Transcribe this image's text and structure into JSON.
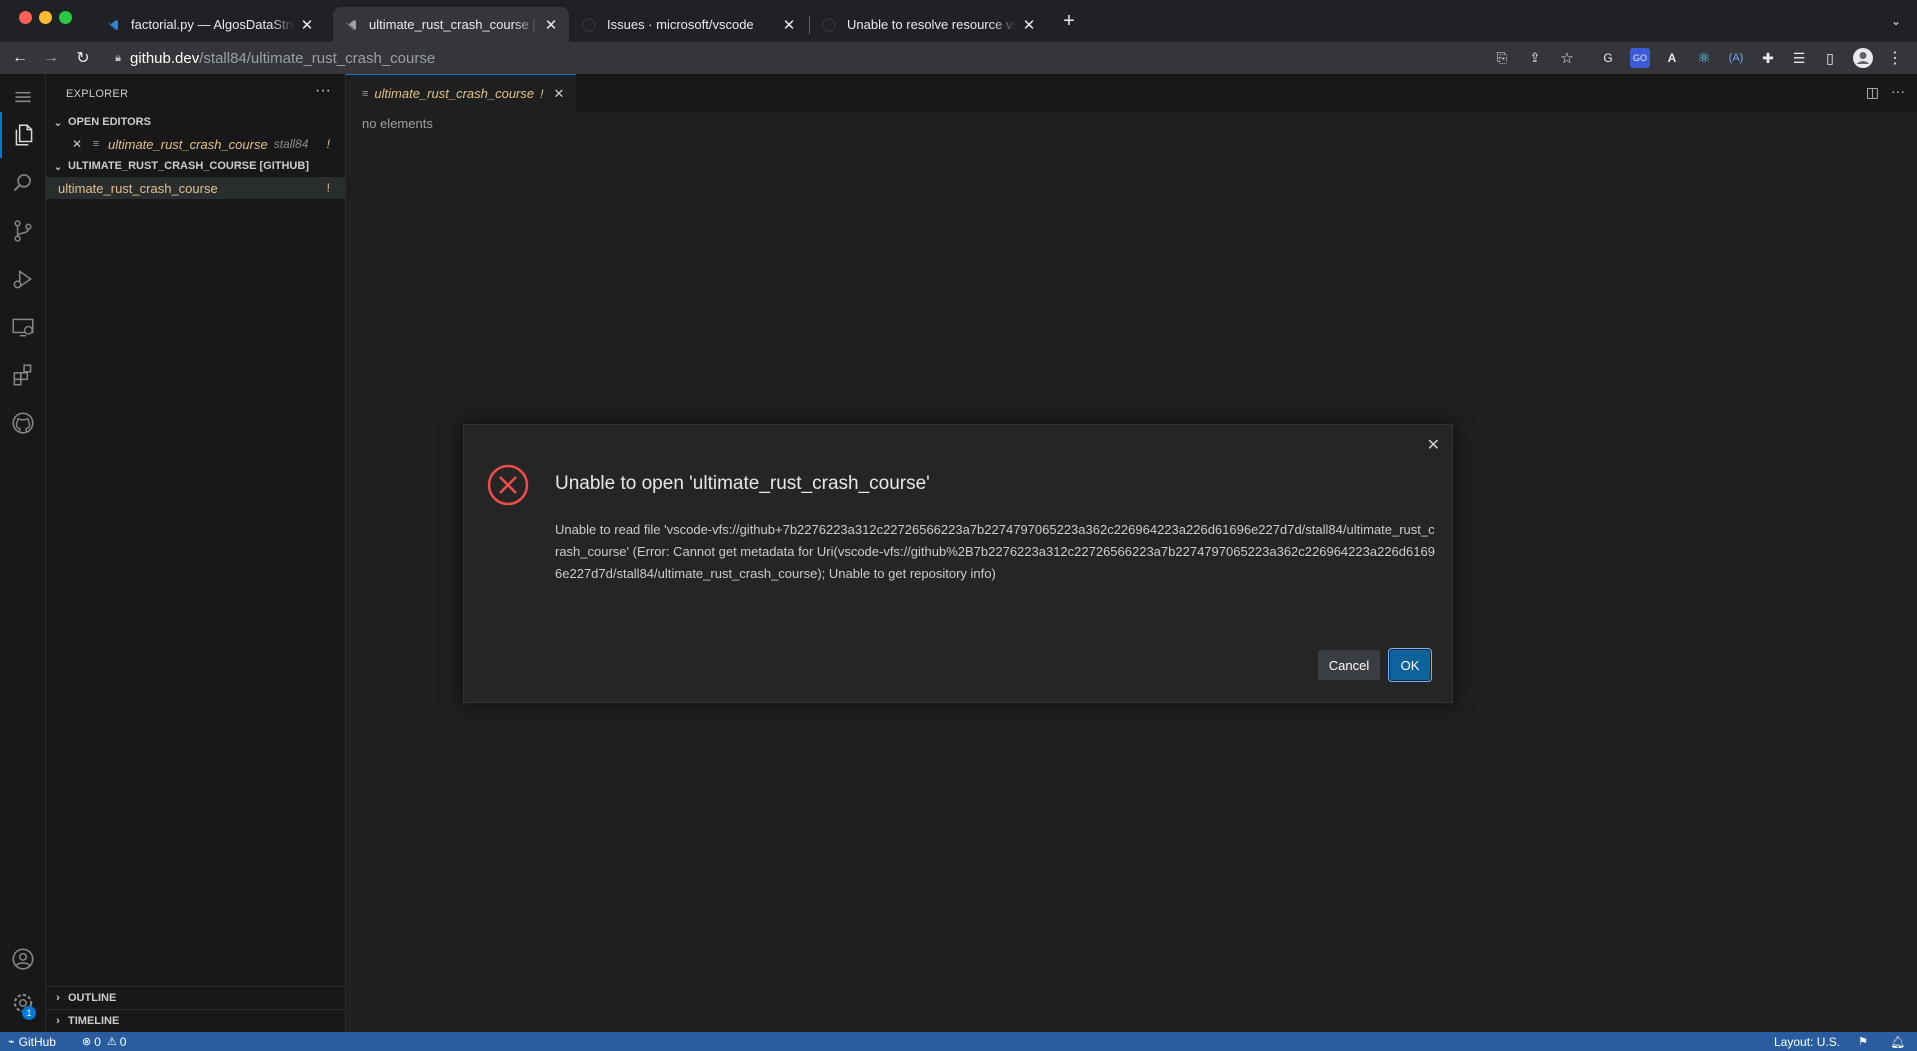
{
  "browser": {
    "tabs": [
      {
        "title": "factorial.py — AlgosDataStructures",
        "favicon": "vscode-icon"
      },
      {
        "title": "ultimate_rust_crash_course [GitHub]",
        "favicon": "vscode-icon"
      },
      {
        "title": "Issues · microsoft/vscode",
        "favicon": "github-icon"
      },
      {
        "title": "Unable to resolve resource vscode",
        "favicon": "github-icon"
      }
    ],
    "url_host": "github.dev",
    "url_path": "/stall84/ultimate_rust_crash_course",
    "extensions": [
      "G",
      "GO",
      "A",
      "⚛",
      "(A)"
    ]
  },
  "explorer": {
    "title": "EXPLORER",
    "open_editors_label": "OPEN EDITORS",
    "open_editor": {
      "name": "ultimate_rust_crash_course",
      "owner": "stall84",
      "badge": "!"
    },
    "repo_label": "ULTIMATE_RUST_CRASH_COURSE [GITHUB]",
    "repo_item": {
      "name": "ultimate_rust_crash_course",
      "badge": "!"
    },
    "outline_label": "OUTLINE",
    "timeline_label": "TIMELINE"
  },
  "editor": {
    "tab": {
      "name": "ultimate_rust_crash_course",
      "badge": "!"
    },
    "empty_text": "no elements"
  },
  "dialog": {
    "title": "Unable to open 'ultimate_rust_crash_course'",
    "message": "Unable to read file 'vscode-vfs://github+7b2276223a312c22726566223a7b2274797065223a362c226964223a226d61696e227d7d/stall84/ultimate_rust_crash_course' (Error: Cannot get metadata for Uri(vscode-vfs://github%2B7b2276223a312c22726566223a7b2274797065223a362c226964223a226d61696e227d7d/stall84/ultimate_rust_crash_course); Unable to get repository info)",
    "cancel_label": "Cancel",
    "ok_label": "OK"
  },
  "statusbar": {
    "remote_label": "GitHub",
    "errors": "0",
    "warnings": "0",
    "layout": "Layout: U.S.",
    "settings_badge": "1"
  },
  "colors": {
    "accent": "#0e639c",
    "statusbar": "#2a5d9f",
    "git_modified": "#e2c08d",
    "error_red": "#f14c4c"
  }
}
